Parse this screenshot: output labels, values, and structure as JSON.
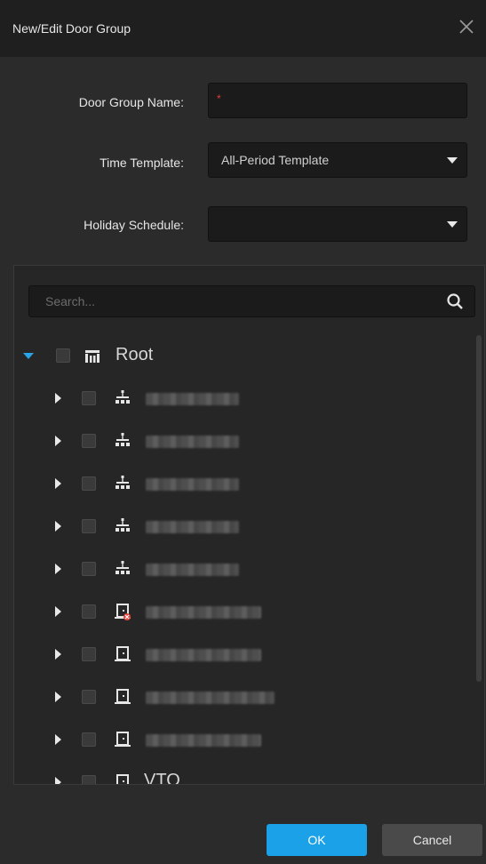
{
  "dialog": {
    "title": "New/Edit Door Group",
    "close_icon": "close-icon"
  },
  "form": {
    "door_group_name_label": "Door Group Name:",
    "door_group_name_value": "",
    "required_mark": "*",
    "time_template_label": "Time Template:",
    "time_template_value": "All-Period Template",
    "holiday_schedule_label": "Holiday Schedule:",
    "holiday_schedule_value": ""
  },
  "tree": {
    "search_placeholder": "Search...",
    "root_label": "Root",
    "items": [
      {
        "icon": "org-unit-icon",
        "label": ""
      },
      {
        "icon": "org-unit-icon",
        "label": ""
      },
      {
        "icon": "org-unit-icon",
        "label": ""
      },
      {
        "icon": "org-unit-icon",
        "label": ""
      },
      {
        "icon": "org-unit-icon",
        "label": ""
      },
      {
        "icon": "door-device-offline-icon",
        "label": ""
      },
      {
        "icon": "door-device-icon",
        "label": ""
      },
      {
        "icon": "door-device-icon",
        "label": ""
      },
      {
        "icon": "door-device-icon",
        "label": ""
      },
      {
        "icon": "door-device-icon",
        "label": "VTO"
      }
    ]
  },
  "footer": {
    "ok_label": "OK",
    "cancel_label": "Cancel"
  },
  "colors": {
    "accent": "#1aa1e8",
    "required": "#e23b3b",
    "background": "#2b2b2b"
  }
}
